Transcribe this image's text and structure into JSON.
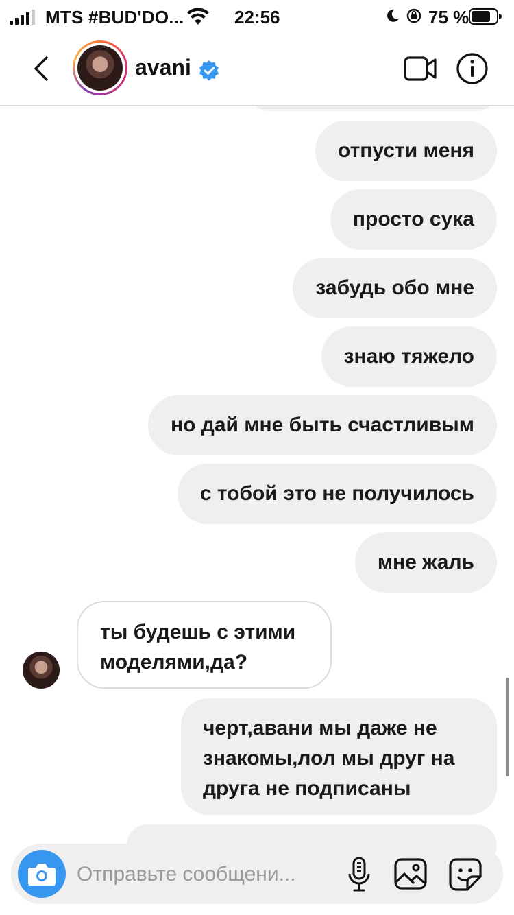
{
  "status_bar": {
    "carrier": "MTS #BUD'DO...",
    "time": "22:56",
    "battery": "75 %"
  },
  "header": {
    "contact_name": "avani",
    "verified_color": "#3897f0",
    "icons": [
      "back-icon",
      "video-call-icon",
      "info-icon",
      "verified-icon"
    ]
  },
  "messages": [
    {
      "side": "outgoing",
      "text": "отпусти меня"
    },
    {
      "side": "outgoing",
      "text": "просто сука"
    },
    {
      "side": "outgoing",
      "text": "забудь обо мне"
    },
    {
      "side": "outgoing",
      "text": "знаю тяжело"
    },
    {
      "side": "outgoing",
      "text": "но дай мне быть счастливым"
    },
    {
      "side": "outgoing",
      "text": "с тобой это не получилось"
    },
    {
      "side": "outgoing",
      "text": "мне жаль"
    },
    {
      "side": "incoming",
      "text": "ты будешь с этими моделями,да?"
    },
    {
      "side": "outgoing",
      "text": "черт,авани мы даже не знакомы,лол мы друг на друга не подписаны"
    }
  ],
  "composer": {
    "placeholder": "Отправьте сообщени...",
    "accent": "#3797f0",
    "icons": [
      "camera-icon",
      "microphone-icon",
      "gallery-icon",
      "sticker-icon"
    ]
  }
}
